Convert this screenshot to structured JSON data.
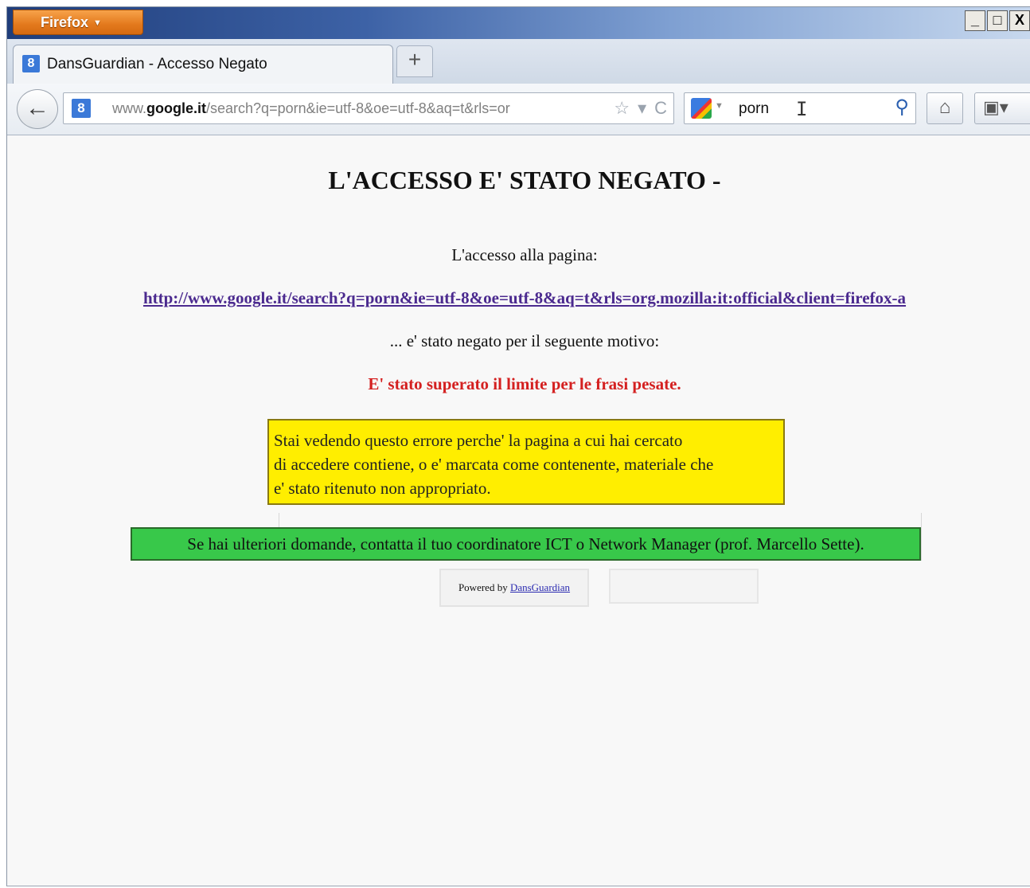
{
  "window": {
    "firefox_button": "Firefox",
    "controls": [
      "_",
      "□",
      "X"
    ]
  },
  "tab": {
    "favicon": "8",
    "title": "DansGuardian - Accesso Negato",
    "new_tab": "+"
  },
  "navbar": {
    "back": "←",
    "url_favicon": "8",
    "url_prefix": "www.",
    "url_domain": "google.it",
    "url_rest": "/search?q=porn&ie=utf-8&oe=utf-8&aq=t&rls=or",
    "star": "☆",
    "dropdown": "▾",
    "reload": "C",
    "search_value": "porn",
    "search_go": "⚲",
    "home": "⌂",
    "bookmarks": "▣▾"
  },
  "page": {
    "heading": "L'ACCESSO E' STATO NEGATO -",
    "access_label": "L'accesso alla pagina:",
    "blocked_url": "http://www.google.it/search?q=porn&ie=utf-8&oe=utf-8&aq=t&rls=org.mozilla:it:official&client=firefox-a",
    "denied_label": "... e' stato negato per il seguente motivo:",
    "reason": "E' stato superato il limite per le frasi pesate.",
    "explanation_line1": "Stai vedendo questo errore perche' la pagina a cui hai cercato",
    "explanation_line2": "di accedere contiene, o e' marcata come contenente, materiale che",
    "explanation_line3": "e' stato ritenuto non appropriato.",
    "contact": "Se hai ulteriori domande, contatta il tuo coordinatore ICT o Network Manager (prof. Marcello Sette).",
    "powered_by": "Powered by",
    "powered_link": "DansGuardian"
  },
  "colors": {
    "yellow_box": "#ffee00",
    "green_box": "#38c84a",
    "reason_text": "#d42020",
    "link": "#4b2a8f"
  }
}
